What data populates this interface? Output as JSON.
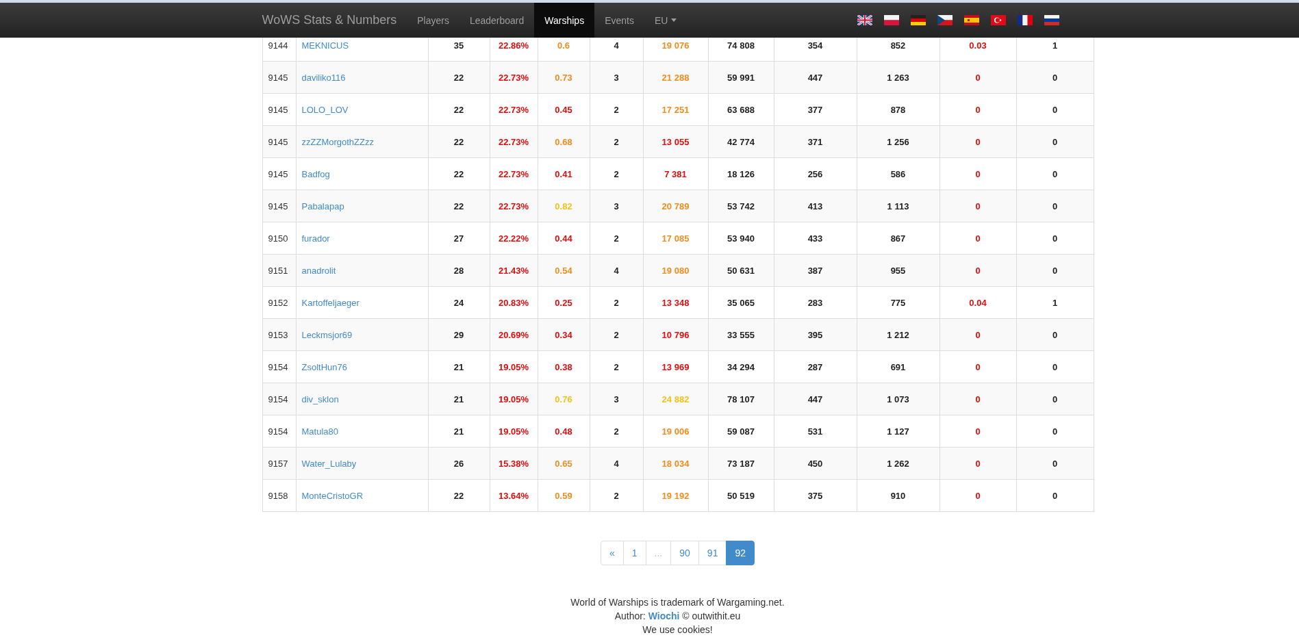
{
  "navbar": {
    "brand": "WoWS Stats & Numbers",
    "items": [
      {
        "label": "Players",
        "selected": false,
        "dropdown": false
      },
      {
        "label": "Leaderboard",
        "selected": false,
        "dropdown": false
      },
      {
        "label": "Warships",
        "selected": true,
        "dropdown": false
      },
      {
        "label": "Events",
        "selected": false,
        "dropdown": false
      },
      {
        "label": "EU",
        "selected": false,
        "dropdown": true
      }
    ],
    "flags": [
      {
        "kind": "uk"
      },
      {
        "kind": "pl"
      },
      {
        "kind": "de"
      },
      {
        "kind": "cz"
      },
      {
        "kind": "es"
      },
      {
        "kind": "tr"
      },
      {
        "kind": "fr"
      },
      {
        "kind": "ru"
      }
    ]
  },
  "table": {
    "rows": [
      {
        "cells": [
          {
            "kind": "rank",
            "text": "9144"
          },
          {
            "kind": "link",
            "text": "MEKNICUS"
          },
          {
            "kind": "num",
            "text": "35"
          },
          {
            "kind": "num",
            "text": "22.86%",
            "color": "#e00d0d"
          },
          {
            "kind": "num",
            "text": "0.6",
            "color": "#f08c1e"
          },
          {
            "kind": "num",
            "text": "4"
          },
          {
            "kind": "num",
            "text": "19 076",
            "color": "#f08c1e"
          },
          {
            "kind": "num",
            "text": "74 808"
          },
          {
            "kind": "num",
            "text": "354"
          },
          {
            "kind": "num",
            "text": "852"
          },
          {
            "kind": "num",
            "text": "0.03",
            "color": "#e00d0d"
          },
          {
            "kind": "num",
            "text": "1"
          }
        ]
      },
      {
        "cells": [
          {
            "kind": "rank",
            "text": "9145"
          },
          {
            "kind": "link",
            "text": "daviliko116"
          },
          {
            "kind": "num",
            "text": "22"
          },
          {
            "kind": "num",
            "text": "22.73%",
            "color": "#e00d0d"
          },
          {
            "kind": "num",
            "text": "0.73",
            "color": "#f08c1e"
          },
          {
            "kind": "num",
            "text": "3"
          },
          {
            "kind": "num",
            "text": "21 288",
            "color": "#f08c1e"
          },
          {
            "kind": "num",
            "text": "59 991"
          },
          {
            "kind": "num",
            "text": "447"
          },
          {
            "kind": "num",
            "text": "1 263"
          },
          {
            "kind": "num",
            "text": "0",
            "color": "#e00d0d"
          },
          {
            "kind": "num",
            "text": "0"
          }
        ]
      },
      {
        "cells": [
          {
            "kind": "rank",
            "text": "9145"
          },
          {
            "kind": "link",
            "text": "LOLO_LOV"
          },
          {
            "kind": "num",
            "text": "22"
          },
          {
            "kind": "num",
            "text": "22.73%",
            "color": "#e00d0d"
          },
          {
            "kind": "num",
            "text": "0.45",
            "color": "#e00d0d"
          },
          {
            "kind": "num",
            "text": "2"
          },
          {
            "kind": "num",
            "text": "17 251",
            "color": "#f08c1e"
          },
          {
            "kind": "num",
            "text": "63 688"
          },
          {
            "kind": "num",
            "text": "377"
          },
          {
            "kind": "num",
            "text": "878"
          },
          {
            "kind": "num",
            "text": "0",
            "color": "#e00d0d"
          },
          {
            "kind": "num",
            "text": "0"
          }
        ]
      },
      {
        "cells": [
          {
            "kind": "rank",
            "text": "9145"
          },
          {
            "kind": "link",
            "text": "zzZZMorgothZZzz"
          },
          {
            "kind": "num",
            "text": "22"
          },
          {
            "kind": "num",
            "text": "22.73%",
            "color": "#e00d0d"
          },
          {
            "kind": "num",
            "text": "0.68",
            "color": "#f08c1e"
          },
          {
            "kind": "num",
            "text": "2"
          },
          {
            "kind": "num",
            "text": "13 055",
            "color": "#e00d0d"
          },
          {
            "kind": "num",
            "text": "42 774"
          },
          {
            "kind": "num",
            "text": "371"
          },
          {
            "kind": "num",
            "text": "1 256"
          },
          {
            "kind": "num",
            "text": "0",
            "color": "#e00d0d"
          },
          {
            "kind": "num",
            "text": "0"
          }
        ]
      },
      {
        "cells": [
          {
            "kind": "rank",
            "text": "9145"
          },
          {
            "kind": "link",
            "text": "Badfog"
          },
          {
            "kind": "num",
            "text": "22"
          },
          {
            "kind": "num",
            "text": "22.73%",
            "color": "#e00d0d"
          },
          {
            "kind": "num",
            "text": "0.41",
            "color": "#e00d0d"
          },
          {
            "kind": "num",
            "text": "2"
          },
          {
            "kind": "num",
            "text": "7 381",
            "color": "#e00d0d"
          },
          {
            "kind": "num",
            "text": "18 126"
          },
          {
            "kind": "num",
            "text": "256"
          },
          {
            "kind": "num",
            "text": "586"
          },
          {
            "kind": "num",
            "text": "0",
            "color": "#e00d0d"
          },
          {
            "kind": "num",
            "text": "0"
          }
        ]
      },
      {
        "cells": [
          {
            "kind": "rank",
            "text": "9145"
          },
          {
            "kind": "link",
            "text": "Pabalapap"
          },
          {
            "kind": "num",
            "text": "22"
          },
          {
            "kind": "num",
            "text": "22.73%",
            "color": "#e00d0d"
          },
          {
            "kind": "num",
            "text": "0.82",
            "color": "#f2c21b"
          },
          {
            "kind": "num",
            "text": "3"
          },
          {
            "kind": "num",
            "text": "20 789",
            "color": "#f08c1e"
          },
          {
            "kind": "num",
            "text": "53 742"
          },
          {
            "kind": "num",
            "text": "413"
          },
          {
            "kind": "num",
            "text": "1 113"
          },
          {
            "kind": "num",
            "text": "0",
            "color": "#e00d0d"
          },
          {
            "kind": "num",
            "text": "0"
          }
        ]
      },
      {
        "cells": [
          {
            "kind": "rank",
            "text": "9150"
          },
          {
            "kind": "link",
            "text": "furador"
          },
          {
            "kind": "num",
            "text": "27"
          },
          {
            "kind": "num",
            "text": "22.22%",
            "color": "#e00d0d"
          },
          {
            "kind": "num",
            "text": "0.44",
            "color": "#e00d0d"
          },
          {
            "kind": "num",
            "text": "2"
          },
          {
            "kind": "num",
            "text": "17 085",
            "color": "#f08c1e"
          },
          {
            "kind": "num",
            "text": "53 940"
          },
          {
            "kind": "num",
            "text": "433"
          },
          {
            "kind": "num",
            "text": "867"
          },
          {
            "kind": "num",
            "text": "0",
            "color": "#e00d0d"
          },
          {
            "kind": "num",
            "text": "0"
          }
        ]
      },
      {
        "cells": [
          {
            "kind": "rank",
            "text": "9151"
          },
          {
            "kind": "link",
            "text": "anadrolit"
          },
          {
            "kind": "num",
            "text": "28"
          },
          {
            "kind": "num",
            "text": "21.43%",
            "color": "#e00d0d"
          },
          {
            "kind": "num",
            "text": "0.54",
            "color": "#f08c1e"
          },
          {
            "kind": "num",
            "text": "4"
          },
          {
            "kind": "num",
            "text": "19 080",
            "color": "#f08c1e"
          },
          {
            "kind": "num",
            "text": "50 631"
          },
          {
            "kind": "num",
            "text": "387"
          },
          {
            "kind": "num",
            "text": "955"
          },
          {
            "kind": "num",
            "text": "0",
            "color": "#e00d0d"
          },
          {
            "kind": "num",
            "text": "0"
          }
        ]
      },
      {
        "cells": [
          {
            "kind": "rank",
            "text": "9152"
          },
          {
            "kind": "link",
            "text": "Kartoffeljaeger"
          },
          {
            "kind": "num",
            "text": "24"
          },
          {
            "kind": "num",
            "text": "20.83%",
            "color": "#e00d0d"
          },
          {
            "kind": "num",
            "text": "0.25",
            "color": "#e00d0d"
          },
          {
            "kind": "num",
            "text": "2"
          },
          {
            "kind": "num",
            "text": "13 348",
            "color": "#e00d0d"
          },
          {
            "kind": "num",
            "text": "35 065"
          },
          {
            "kind": "num",
            "text": "283"
          },
          {
            "kind": "num",
            "text": "775"
          },
          {
            "kind": "num",
            "text": "0.04",
            "color": "#e00d0d"
          },
          {
            "kind": "num",
            "text": "1"
          }
        ]
      },
      {
        "cells": [
          {
            "kind": "rank",
            "text": "9153"
          },
          {
            "kind": "link",
            "text": "Leckmsjor69"
          },
          {
            "kind": "num",
            "text": "29"
          },
          {
            "kind": "num",
            "text": "20.69%",
            "color": "#e00d0d"
          },
          {
            "kind": "num",
            "text": "0.34",
            "color": "#e00d0d"
          },
          {
            "kind": "num",
            "text": "2"
          },
          {
            "kind": "num",
            "text": "10 796",
            "color": "#e00d0d"
          },
          {
            "kind": "num",
            "text": "33 555"
          },
          {
            "kind": "num",
            "text": "395"
          },
          {
            "kind": "num",
            "text": "1 212"
          },
          {
            "kind": "num",
            "text": "0",
            "color": "#e00d0d"
          },
          {
            "kind": "num",
            "text": "0"
          }
        ]
      },
      {
        "cells": [
          {
            "kind": "rank",
            "text": "9154"
          },
          {
            "kind": "link",
            "text": "ZsoltHun76"
          },
          {
            "kind": "num",
            "text": "21"
          },
          {
            "kind": "num",
            "text": "19.05%",
            "color": "#e00d0d"
          },
          {
            "kind": "num",
            "text": "0.38",
            "color": "#e00d0d"
          },
          {
            "kind": "num",
            "text": "2"
          },
          {
            "kind": "num",
            "text": "13 969",
            "color": "#e00d0d"
          },
          {
            "kind": "num",
            "text": "34 294"
          },
          {
            "kind": "num",
            "text": "287"
          },
          {
            "kind": "num",
            "text": "691"
          },
          {
            "kind": "num",
            "text": "0",
            "color": "#e00d0d"
          },
          {
            "kind": "num",
            "text": "0"
          }
        ]
      },
      {
        "cells": [
          {
            "kind": "rank",
            "text": "9154"
          },
          {
            "kind": "link",
            "text": "div_sklon"
          },
          {
            "kind": "num",
            "text": "21"
          },
          {
            "kind": "num",
            "text": "19.05%",
            "color": "#e00d0d"
          },
          {
            "kind": "num",
            "text": "0.76",
            "color": "#f2c21b"
          },
          {
            "kind": "num",
            "text": "3"
          },
          {
            "kind": "num",
            "text": "24 882",
            "color": "#f2c21b"
          },
          {
            "kind": "num",
            "text": "78 107"
          },
          {
            "kind": "num",
            "text": "447"
          },
          {
            "kind": "num",
            "text": "1 073"
          },
          {
            "kind": "num",
            "text": "0",
            "color": "#e00d0d"
          },
          {
            "kind": "num",
            "text": "0"
          }
        ]
      },
      {
        "cells": [
          {
            "kind": "rank",
            "text": "9154"
          },
          {
            "kind": "link",
            "text": "Matula80"
          },
          {
            "kind": "num",
            "text": "21"
          },
          {
            "kind": "num",
            "text": "19.05%",
            "color": "#e00d0d"
          },
          {
            "kind": "num",
            "text": "0.48",
            "color": "#e00d0d"
          },
          {
            "kind": "num",
            "text": "2"
          },
          {
            "kind": "num",
            "text": "19 006",
            "color": "#f08c1e"
          },
          {
            "kind": "num",
            "text": "59 087"
          },
          {
            "kind": "num",
            "text": "531"
          },
          {
            "kind": "num",
            "text": "1 127"
          },
          {
            "kind": "num",
            "text": "0",
            "color": "#e00d0d"
          },
          {
            "kind": "num",
            "text": "0"
          }
        ]
      },
      {
        "cells": [
          {
            "kind": "rank",
            "text": "9157"
          },
          {
            "kind": "link",
            "text": "Water_Lulaby"
          },
          {
            "kind": "num",
            "text": "26"
          },
          {
            "kind": "num",
            "text": "15.38%",
            "color": "#e00d0d"
          },
          {
            "kind": "num",
            "text": "0.65",
            "color": "#f08c1e"
          },
          {
            "kind": "num",
            "text": "4"
          },
          {
            "kind": "num",
            "text": "18 034",
            "color": "#f08c1e"
          },
          {
            "kind": "num",
            "text": "73 187"
          },
          {
            "kind": "num",
            "text": "450"
          },
          {
            "kind": "num",
            "text": "1 262"
          },
          {
            "kind": "num",
            "text": "0",
            "color": "#e00d0d"
          },
          {
            "kind": "num",
            "text": "0"
          }
        ]
      },
      {
        "cells": [
          {
            "kind": "rank",
            "text": "9158"
          },
          {
            "kind": "link",
            "text": "MonteCristoGR"
          },
          {
            "kind": "num",
            "text": "22"
          },
          {
            "kind": "num",
            "text": "13.64%",
            "color": "#e00d0d"
          },
          {
            "kind": "num",
            "text": "0.59",
            "color": "#f08c1e"
          },
          {
            "kind": "num",
            "text": "2"
          },
          {
            "kind": "num",
            "text": "19 192",
            "color": "#f08c1e"
          },
          {
            "kind": "num",
            "text": "50 519"
          },
          {
            "kind": "num",
            "text": "375"
          },
          {
            "kind": "num",
            "text": "910"
          },
          {
            "kind": "num",
            "text": "0",
            "color": "#e00d0d"
          },
          {
            "kind": "num",
            "text": "0"
          }
        ]
      }
    ]
  },
  "pagination": {
    "items": [
      {
        "label": "«",
        "selected": false,
        "disabled": false
      },
      {
        "label": "1",
        "selected": false,
        "disabled": false
      },
      {
        "label": "...",
        "selected": false,
        "disabled": true
      },
      {
        "label": "90",
        "selected": false,
        "disabled": false
      },
      {
        "label": "91",
        "selected": false,
        "disabled": false
      },
      {
        "label": "92",
        "selected": true,
        "disabled": false
      }
    ]
  },
  "footer": {
    "trademark": "World of Warships is trademark of Wargaming.net.",
    "author_label": "Author:",
    "author_link": "Wiochi",
    "copyright": "© outwithit.eu",
    "cookies": "We use cookies!"
  }
}
